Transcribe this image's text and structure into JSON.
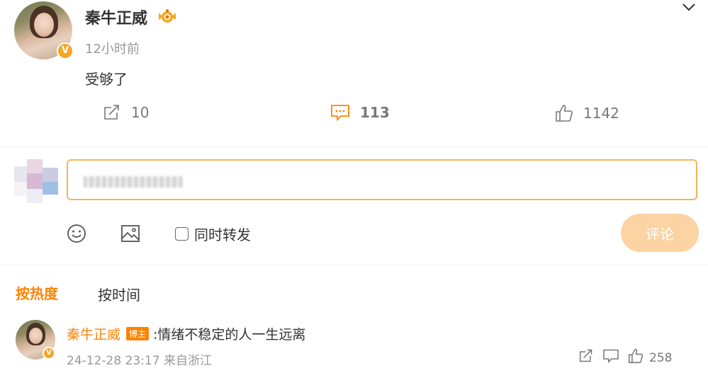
{
  "post": {
    "author": "秦牛正威",
    "time": "12小时前",
    "content": "受够了",
    "repost_count": "10",
    "comment_count": "113",
    "like_count": "1142"
  },
  "composer": {
    "submit_label": "评论",
    "sync_repost_label": "同时转发"
  },
  "sort": {
    "hot": "按热度",
    "time": "按时间"
  },
  "comments": [
    {
      "author": "秦牛正威",
      "badge": "博主",
      "text": ":情绪不稳定的人一生远离",
      "meta": "24-12-28 23:17 来自浙江",
      "like_count": "258"
    }
  ],
  "colors": {
    "accent": "#ff8200",
    "input_border": "#f7b45b",
    "submit_bg": "#fcd3a3",
    "verified": "#f5a623"
  }
}
